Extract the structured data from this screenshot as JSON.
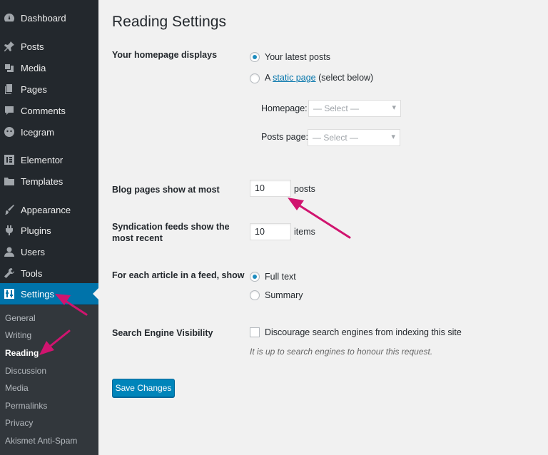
{
  "sidebar": {
    "items": [
      {
        "label": "Dashboard",
        "icon": "dashboard-icon"
      },
      {
        "label": "Posts",
        "icon": "pin-icon"
      },
      {
        "label": "Media",
        "icon": "media-icon"
      },
      {
        "label": "Pages",
        "icon": "pages-icon"
      },
      {
        "label": "Comments",
        "icon": "comment-icon"
      },
      {
        "label": "Icegram",
        "icon": "icegram-icon"
      },
      {
        "label": "Elementor",
        "icon": "elementor-icon"
      },
      {
        "label": "Templates",
        "icon": "folder-icon"
      },
      {
        "label": "Appearance",
        "icon": "brush-icon"
      },
      {
        "label": "Plugins",
        "icon": "plugin-icon"
      },
      {
        "label": "Users",
        "icon": "user-icon"
      },
      {
        "label": "Tools",
        "icon": "wrench-icon"
      },
      {
        "label": "Settings",
        "icon": "settings-icon"
      }
    ],
    "submenu": [
      "General",
      "Writing",
      "Reading",
      "Discussion",
      "Media",
      "Permalinks",
      "Privacy",
      "Akismet Anti-Spam"
    ],
    "active_submenu": "Reading"
  },
  "main": {
    "title": "Reading Settings",
    "homepage": {
      "label": "Your homepage displays",
      "option_latest": "Your latest posts",
      "option_static_prefix": "A",
      "option_static_link": "static page",
      "option_static_suffix": "(select below)",
      "homepage_label": "Homepage:",
      "homepage_select": "— Select —",
      "posts_page_label": "Posts page:",
      "posts_page_select": "— Select —",
      "selected": "latest"
    },
    "blog_pages": {
      "label": "Blog pages show at most",
      "value": "10",
      "unit": "posts"
    },
    "syndication": {
      "label_line1": "Syndication feeds show the",
      "label_line2": "most recent",
      "value": "10",
      "unit": "items"
    },
    "feed_article": {
      "label": "For each article in a feed, show",
      "option_full": "Full text",
      "option_summary": "Summary",
      "selected": "full"
    },
    "search_visibility": {
      "label": "Search Engine Visibility",
      "checkbox_label": "Discourage search engines from indexing this site",
      "checked": false,
      "description": "It is up to search engines to honour this request."
    },
    "save_button": "Save Changes"
  },
  "colors": {
    "sidebar_bg": "#23282d",
    "submenu_bg": "#32373c",
    "accent": "#0073aa",
    "arrow": "#d0146f"
  }
}
